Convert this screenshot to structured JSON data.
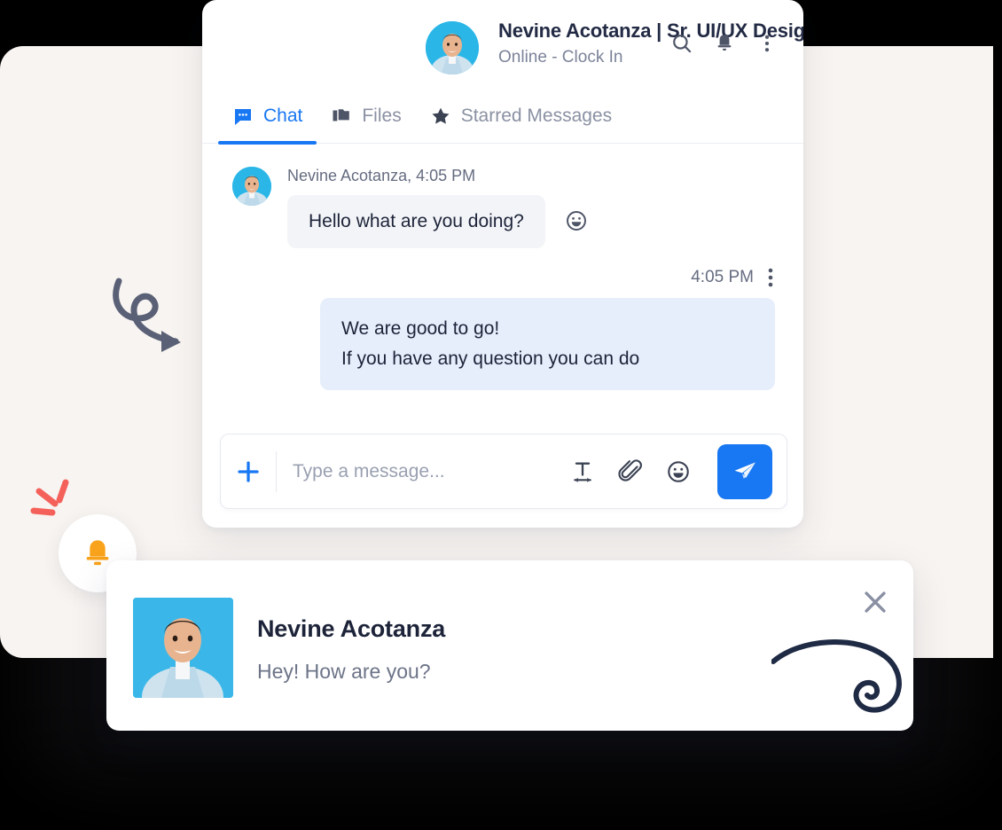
{
  "theme": {
    "accent_blue": "#1877f2",
    "bubble_in_bg": "#f3f4f8",
    "bubble_out_bg": "#e6edfb",
    "page_bg": "#f8f4f1",
    "title_color": "#222a44",
    "muted_color": "#7c8399",
    "bell_orange": "#f9a21b",
    "spark_red": "#f4615a",
    "swirl_navy": "#1f2a44"
  },
  "chat_panel": {
    "header": {
      "avatar": "user-avatar-nevine",
      "title": "Nevine Acotanza | Sr. UI/UX Designer",
      "status": "Online -  Clock In",
      "actions": [
        {
          "name": "search-icon",
          "label": "Search"
        },
        {
          "name": "bell-icon",
          "label": "Notifications"
        },
        {
          "name": "more-vertical-icon",
          "label": "More options"
        }
      ]
    },
    "tabs": [
      {
        "label": "Chat",
        "icon": "chat-bubble-icon",
        "active": true
      },
      {
        "label": "Files",
        "icon": "folder-copy-icon",
        "active": false
      },
      {
        "label": "Starred Messages",
        "icon": "star-icon",
        "active": false
      }
    ],
    "messages": [
      {
        "direction": "incoming",
        "meta": "Nevine Acotanza, 4:05 PM",
        "text": "Hello what are you doing?",
        "reaction_icon": "smiley-face-icon"
      },
      {
        "direction": "outgoing",
        "time": "4:05 PM",
        "line1": "We are good to go!",
        "line2": "If you have any question you can do"
      }
    ],
    "composer": {
      "add_label": "+",
      "placeholder": "Type a message...",
      "value": "",
      "icons": [
        {
          "name": "text-format-icon",
          "label": "Formatting"
        },
        {
          "name": "paperclip-icon",
          "label": "Attach file"
        },
        {
          "name": "emoji-icon",
          "label": "Emoji"
        }
      ],
      "send_label": "Send"
    }
  },
  "notification_card": {
    "avatar": "user-avatar-nevine",
    "name": "Nevine Acotanza",
    "message": "Hey! How are you?",
    "close_label": "Close"
  },
  "decorations": {
    "bell_badge": "bell-icon",
    "spark": "spark-lines-icon",
    "loop_arrow": "loop-arrow-icon",
    "swirl": "swirl-flourish-icon"
  }
}
